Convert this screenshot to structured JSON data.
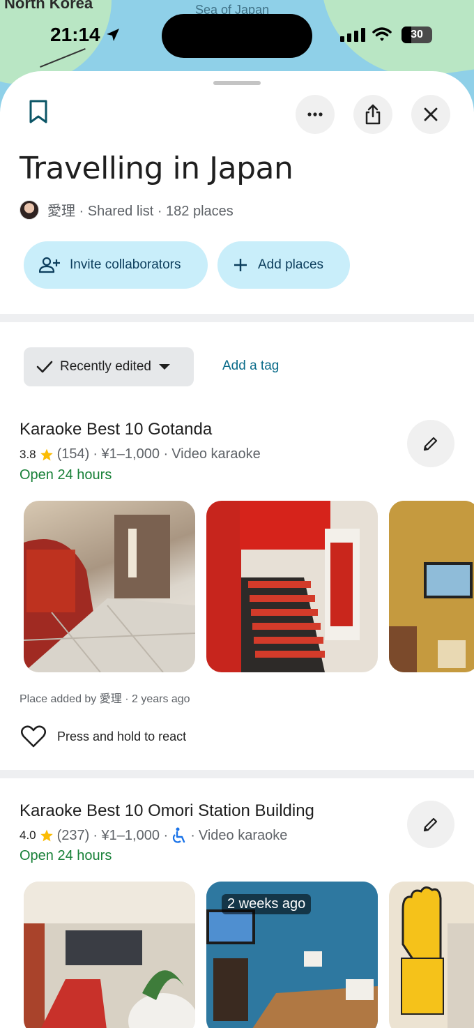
{
  "map": {
    "top_label": "North Korea",
    "sea_label": "Sea of Japan"
  },
  "status_bar": {
    "time": "21:14",
    "battery": "30"
  },
  "list": {
    "title": "Travelling in Japan",
    "meta": "愛理 · Shared list · 182 places",
    "invite_label": "Invite collaborators",
    "add_places_label": "Add places"
  },
  "sort": {
    "label": "Recently edited",
    "add_tag": "Add a tag"
  },
  "places": [
    {
      "name": "Karaoke Best 10 Gotanda",
      "rating": "3.8",
      "reviews": "(154)",
      "price": "· ¥1–1,000 ·",
      "category": "Video karaoke",
      "hours": "Open 24 hours",
      "added_by": "Place added by 愛理 · 2 years ago",
      "react": "Press and hold to react"
    },
    {
      "name": "Karaoke Best 10 Omori Station Building",
      "rating": "4.0",
      "reviews": "(237)",
      "price": "· ¥1–1,000 ·",
      "accessible_sep": "·",
      "category": "Video karaoke",
      "hours": "Open 24 hours",
      "photo_badge": "2 weeks ago"
    }
  ],
  "icons": [
    "bookmark-icon",
    "more-icon",
    "share-icon",
    "close-icon",
    "add-person-icon",
    "plus-icon",
    "check-icon",
    "dropdown-icon",
    "star-icon",
    "pencil-icon",
    "heart-icon",
    "wheelchair-icon"
  ],
  "colors": {
    "accent_pill": "#c9eefa",
    "open_green": "#188038",
    "link": "#0b6c8a",
    "star": "#fbbc04"
  }
}
